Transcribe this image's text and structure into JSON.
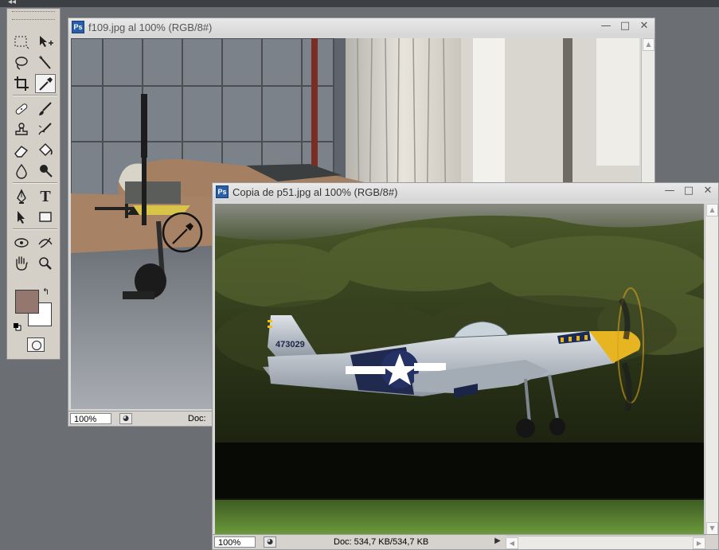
{
  "toolbar_panel": {
    "collapse_glyph": "◂◂",
    "tools": [
      {
        "name": "marquee-icon"
      },
      {
        "name": "move-icon"
      },
      {
        "name": "lasso-icon"
      },
      {
        "name": "magic-wand-icon"
      },
      {
        "name": "crop-icon"
      },
      {
        "name": "eyedropper-icon"
      },
      {
        "name": "healing-brush-icon"
      },
      {
        "name": "brush-icon"
      },
      {
        "name": "clone-stamp-icon"
      },
      {
        "name": "history-brush-icon"
      },
      {
        "name": "eraser-icon"
      },
      {
        "name": "paint-bucket-icon"
      },
      {
        "name": "blur-icon"
      },
      {
        "name": "dodge-icon"
      },
      {
        "name": "pen-icon"
      },
      {
        "name": "type-icon"
      },
      {
        "name": "path-selection-icon"
      },
      {
        "name": "rectangle-shape-icon"
      },
      {
        "name": "3d-rotate-icon"
      },
      {
        "name": "3d-orbit-icon"
      },
      {
        "name": "hand-icon"
      },
      {
        "name": "zoom-icon"
      }
    ],
    "type_tool_glyph": "T",
    "active_tool": "eyedropper-icon",
    "foreground_color": "#94776e",
    "background_color": "#ffffff",
    "swap_glyph": "↰"
  },
  "window_back": {
    "app_badge": "Ps",
    "title": "f109.jpg al 100% (RGB/8#)",
    "controls": {
      "minimize": "—",
      "maximize": "□",
      "close": "✕"
    },
    "status": {
      "zoom": "100%",
      "doc_label": "Doc:"
    }
  },
  "window_front": {
    "app_badge": "Ps",
    "title": "Copia de p51.jpg al 100% (RGB/8#)",
    "controls": {
      "minimize": "—",
      "maximize": "□",
      "close": "✕"
    },
    "status": {
      "zoom": "100%",
      "doc_info": "Doc: 534,7 KB/534,7 KB",
      "menu_arrow": "▶"
    },
    "aircraft_serial": "473029"
  },
  "scroll_glyphs": {
    "up": "▲",
    "down": "▼",
    "left": "◀",
    "right": "▶"
  }
}
